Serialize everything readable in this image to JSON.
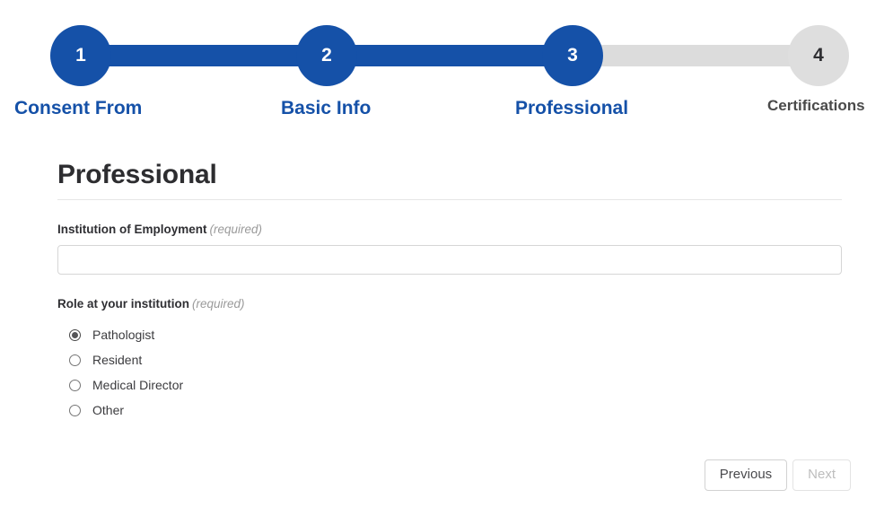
{
  "theme": {
    "accent": "#1551a8",
    "inactive": "#dedede",
    "text_dark": "#2d2d30",
    "text_muted": "#9a9a9a"
  },
  "stepper": {
    "steps": [
      {
        "number": "1",
        "label": "Consent From",
        "state": "done"
      },
      {
        "number": "2",
        "label": "Basic Info",
        "state": "done"
      },
      {
        "number": "3",
        "label": "Professional",
        "state": "current"
      },
      {
        "number": "4",
        "label": "Certifications",
        "state": "upcoming"
      }
    ]
  },
  "form": {
    "title": "Professional",
    "institution": {
      "label": "Institution of Employment",
      "required_note": "(required)",
      "value": "",
      "placeholder": ""
    },
    "role": {
      "label": "Role at your institution",
      "required_note": "(required)",
      "selected": "Pathologist",
      "options": [
        {
          "label": "Pathologist",
          "checked": true
        },
        {
          "label": "Resident",
          "checked": false
        },
        {
          "label": "Medical Director",
          "checked": false
        },
        {
          "label": "Other",
          "checked": false
        }
      ]
    }
  },
  "footer": {
    "previous_label": "Previous",
    "next_label": "Next",
    "next_disabled": true
  }
}
